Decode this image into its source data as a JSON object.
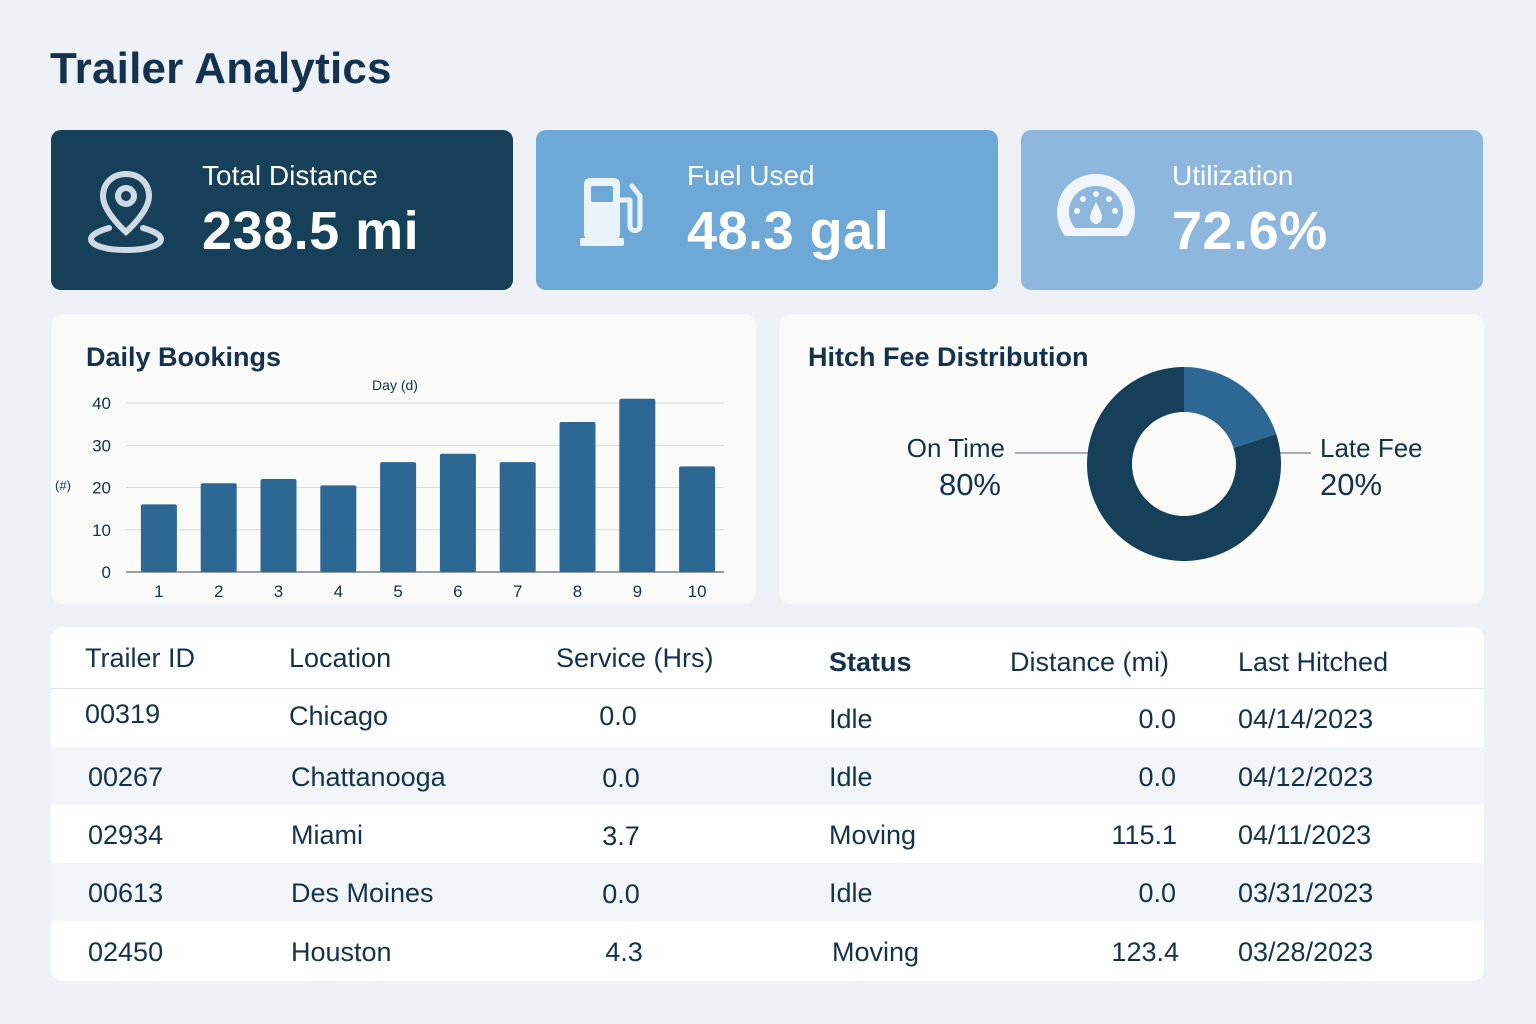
{
  "header": {
    "title": "Trailer Analytics"
  },
  "kpis": [
    {
      "label": "Total Distance",
      "value": "238.5 mi",
      "icon": "map-pin-icon",
      "color": "#163f5a"
    },
    {
      "label": "Fuel Used",
      "value": "48.3 gal",
      "icon": "fuel-pump-icon",
      "color": "#6ea8d6"
    },
    {
      "label": "Utilization",
      "value": "72.6%",
      "icon": "gauge-icon",
      "color": "#8db7dc"
    }
  ],
  "bookings": {
    "title": "Daily Bookings",
    "chart_data": {
      "type": "bar",
      "title": "Daily Bookings",
      "xlabel": "Day (d)",
      "ylabel": "(#)",
      "categories": [
        "1",
        "2",
        "3",
        "4",
        "5",
        "6",
        "7",
        "8",
        "9",
        "10"
      ],
      "values": [
        16,
        21,
        22,
        20.5,
        26,
        28,
        26,
        35.5,
        41,
        25
      ],
      "ylim": [
        0,
        40
      ],
      "yticks": [
        0,
        10,
        20,
        30,
        40
      ],
      "grid": true,
      "bar_color": "#2d6895"
    }
  },
  "fees": {
    "title": "Hitch Fee Distribution",
    "chart_data": {
      "type": "pie",
      "title": "Hitch Fee Distribution",
      "slices": [
        {
          "label": "On Time",
          "value": 80,
          "display": "80%",
          "color": "#163f5a"
        },
        {
          "label": "Late Fee",
          "value": 20,
          "display": "20%",
          "color": "#2d6895"
        }
      ],
      "donut": true
    }
  },
  "table": {
    "columns": [
      "Trailer ID",
      "Location",
      "Service (Hrs)",
      "Status",
      "Distance (mi)",
      "Last Hitched"
    ],
    "rows": [
      [
        "00319",
        "Chicago",
        "0.0",
        "Idle",
        "0.0",
        "04/14/2023"
      ],
      [
        "00267",
        "Chattanooga",
        "0.0",
        "Idle",
        "0.0",
        "04/12/2023"
      ],
      [
        "02934",
        "Miami",
        "3.7",
        "Moving",
        "115.1",
        "04/11/2023"
      ],
      [
        "00613",
        "Des Moines",
        "0.0",
        "Idle",
        "0.0",
        "03/31/2023"
      ],
      [
        "02450",
        "Houston",
        "4.3",
        "Moving",
        "123.4",
        "03/28/2023"
      ]
    ]
  }
}
